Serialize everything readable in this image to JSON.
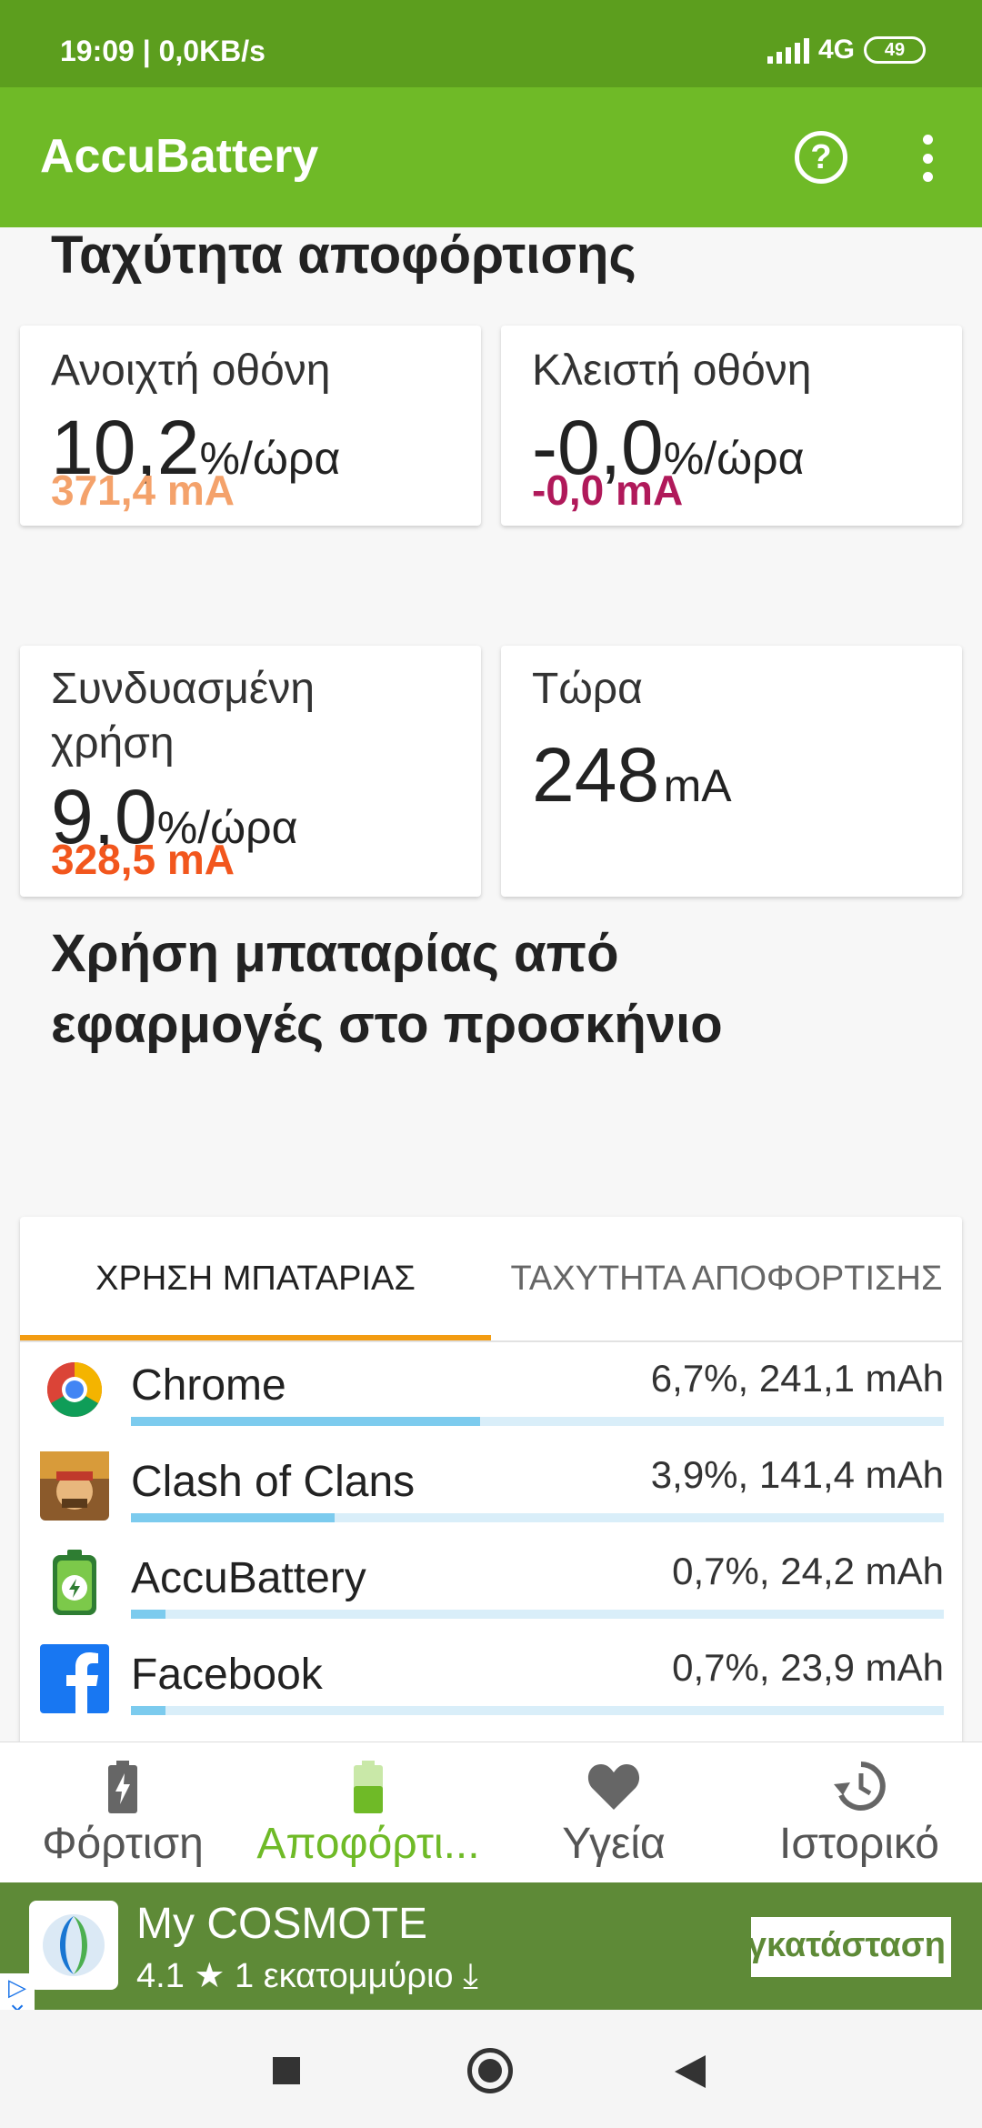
{
  "status_bar": {
    "time_speed": "19:09 | 0,0KB/s",
    "network": "4G",
    "battery_level": "49"
  },
  "app_bar": {
    "title": "AccuBattery",
    "help_icon": "help-circle-icon",
    "menu_icon": "more-vert-icon"
  },
  "discharge": {
    "title": "Ταχύτητα αποφόρτισης",
    "screen_on": {
      "label": "Ανοιχτή οθόνη",
      "value": "10,2",
      "unit": "%/ώρα",
      "ma": "371,4 mA",
      "ma_color": "#f4a26b"
    },
    "screen_off": {
      "label": "Κλειστή οθόνη",
      "value": "-0,0",
      "unit": "%/ώρα",
      "ma": "-0,0 mA",
      "ma_color": "#b0195a"
    },
    "combined": {
      "label": "Συνδυασμένη χρήση",
      "value": "9,0",
      "unit": "%/ώρα",
      "ma": "328,5 mA",
      "ma_color": "#f2561d"
    },
    "now": {
      "label": "Τώρα",
      "value": "248",
      "unit": "mA"
    }
  },
  "usage": {
    "title": "Χρήση μπαταρίας από εφαρμογές στο προσκήνιο",
    "tabs": [
      "ΧΡΗΣΗ ΜΠΑΤΑΡΙΑΣ",
      "ΤΑΧΥΤΗΤΑ ΑΠΟΦΟΡΤΙΣΗΣ"
    ],
    "apps": [
      {
        "name": "Chrome",
        "stat": "6,7%, 241,1 mAh",
        "fraction": 0.43,
        "icon": "chrome-icon"
      },
      {
        "name": "Clash of Clans",
        "stat": "3,9%, 141,4 mAh",
        "fraction": 0.25,
        "icon": "clash-of-clans-icon"
      },
      {
        "name": "AccuBattery",
        "stat": "0,7%, 24,2 mAh",
        "fraction": 0.042,
        "icon": "accubattery-icon"
      },
      {
        "name": "Facebook",
        "stat": "0,7%, 23,9 mAh",
        "fraction": 0.042,
        "icon": "facebook-icon"
      }
    ]
  },
  "bottom_nav": [
    {
      "label": "Φόρτιση",
      "icon": "charging-icon",
      "active": false
    },
    {
      "label": "Αποφόρτι...",
      "icon": "discharging-battery-icon",
      "active": true
    },
    {
      "label": "Υγεία",
      "icon": "heart-icon",
      "active": false
    },
    {
      "label": "Ιστορικό",
      "icon": "history-icon",
      "active": false
    }
  ],
  "ad": {
    "app_name": "My COSMOTE",
    "rating": "4.1",
    "downloads": "1 εκατομμύριο",
    "button": "Εγκατάσταση"
  },
  "colors": {
    "status_bar": "#5c9e1e",
    "app_bar": "#6fba27",
    "tab_underline": "#f39c12",
    "usage_bar": "#7ccbee",
    "ad_background": "#5e8a37"
  }
}
